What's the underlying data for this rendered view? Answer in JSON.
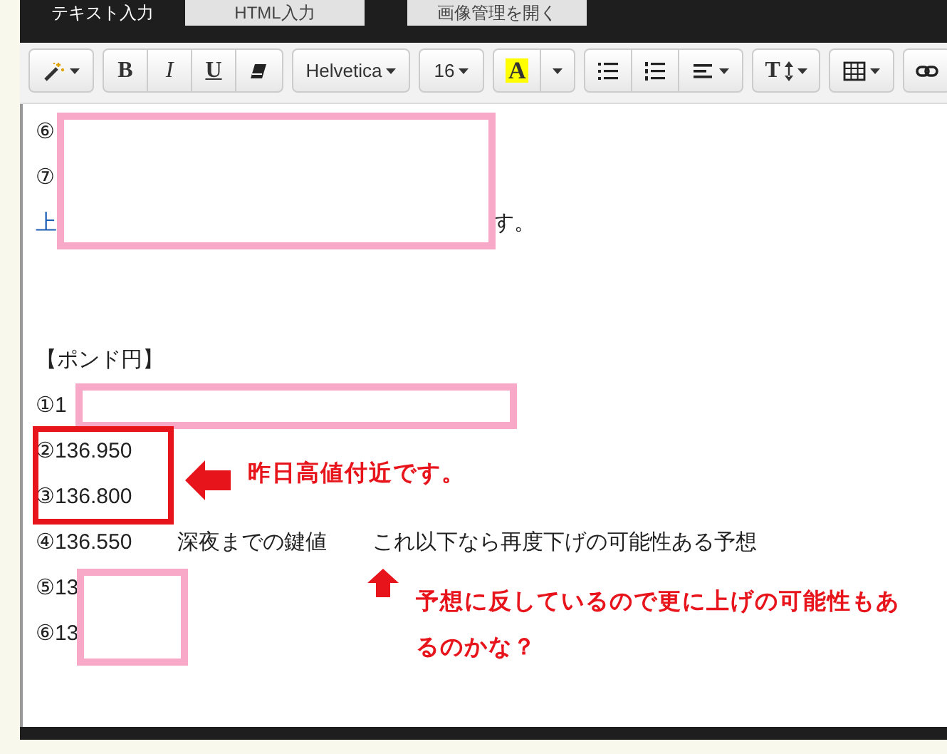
{
  "tabs": [
    {
      "label": "テキスト入力",
      "selected": true
    },
    {
      "label": "HTML入力",
      "selected": false
    },
    {
      "label": "画像管理を開く",
      "selected": false
    }
  ],
  "toolbar": [
    [
      {
        "kind": "wand"
      }
    ],
    [
      {
        "kind": "bold",
        "label": "B"
      },
      {
        "kind": "italic",
        "label": "I"
      },
      {
        "kind": "underline",
        "label": "U"
      },
      {
        "kind": "eraser"
      }
    ],
    [
      {
        "kind": "font",
        "label": "Helvetica"
      }
    ],
    [
      {
        "kind": "size",
        "label": "16"
      }
    ],
    [
      {
        "kind": "highlight",
        "label": "A"
      },
      {
        "kind": "caret"
      }
    ],
    [
      {
        "kind": "bullets"
      },
      {
        "kind": "numbers"
      },
      {
        "kind": "align"
      }
    ],
    [
      {
        "kind": "textsize",
        "label": "T"
      }
    ],
    [
      {
        "kind": "table"
      }
    ],
    [
      {
        "kind": "link"
      }
    ]
  ],
  "lines": [
    {
      "kind": "text",
      "segments": [
        {
          "text": "⑥",
          "kind": "plain"
        }
      ]
    },
    {
      "kind": "text",
      "segments": [
        {
          "text": "⑦",
          "kind": "plain"
        }
      ]
    },
    {
      "kind": "covered",
      "segments": [
        {
          "text": "上",
          "kind": "link"
        },
        {
          "text": "す。",
          "kind": "plain"
        }
      ]
    },
    {
      "kind": "blank"
    },
    {
      "kind": "blank"
    },
    {
      "kind": "text",
      "segments": [
        {
          "text": "【ポンド円】",
          "kind": "plain"
        }
      ]
    },
    {
      "kind": "text",
      "segments": [
        {
          "text": "①1",
          "kind": "plain"
        }
      ]
    },
    {
      "kind": "text",
      "segments": [
        {
          "text": "②136.950",
          "kind": "plain"
        }
      ]
    },
    {
      "kind": "text",
      "segments": [
        {
          "text": "③136.800",
          "kind": "plain"
        }
      ]
    },
    {
      "kind": "text",
      "segments": [
        {
          "text": "④136.550",
          "kind": "plain"
        },
        {
          "text": "深夜までの鍵値",
          "kind": "plain"
        },
        {
          "text": "これ以下なら再度下げの可能性ある予想",
          "kind": "plain"
        }
      ]
    },
    {
      "kind": "text",
      "segments": [
        {
          "text": "⑤13",
          "kind": "plain"
        }
      ]
    },
    {
      "kind": "text",
      "segments": [
        {
          "text": "⑥13",
          "kind": "plain"
        }
      ]
    }
  ],
  "notes": [
    {
      "kind": "left-arrow",
      "text": "昨日高値付近です。"
    },
    {
      "kind": "up-arrow",
      "text": "予想に反しているので更に上げの可能性もあるのかな？"
    }
  ]
}
